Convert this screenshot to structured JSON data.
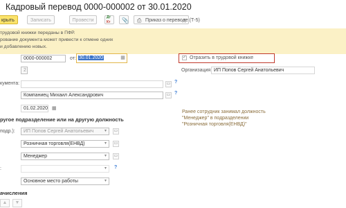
{
  "title": "Кадровый перевод 0000-000002 от 30.01.2020",
  "toolbar": {
    "close_label": "крыть",
    "save_label": "Записать",
    "post_label": "Провести",
    "order_label": "Приказ о переводе (Т-5)"
  },
  "notice": {
    "line1": "трудовой книжки переданы в ПФР.",
    "line2": "рование документа может привести к отмене одних",
    "line3": "и добавлению новых."
  },
  "doc": {
    "number": "0000-000002",
    "date_label": "от:",
    "date": "30.01.2020",
    "small_field": "2"
  },
  "reflect_checkbox": {
    "label": "Отразить в трудовой книжке",
    "checked": true
  },
  "organization": {
    "label": "Организация:",
    "value": "ИП Попов Сергей Анатольевич"
  },
  "employee": {
    "doc_label": "кумента:",
    "name": "Компаниец Михаил Александрович",
    "date": "01.02.2020"
  },
  "transfer": {
    "section_label": "ругое подразделение или на другую должность",
    "org_label": "подр.):",
    "org_value": "ИП Попов Сергей Анатольевич",
    "department": "Розничная торговля(ЕНВД)",
    "position": "Менеджер",
    "work_type": "Основное место работы"
  },
  "previous": {
    "line1": "Ранее сотрудник занимал должность",
    "line2": "\"Менеджер\" в подразделении",
    "line3": "\"Розничная торговля(ЕНВД)\""
  },
  "accruals": {
    "section_label": "ачисления"
  },
  "colors": {
    "accent_yellow": "#fbe36b",
    "notice_bg": "#fbf1c6",
    "highlight_red": "#c0392b",
    "date_blue": "#3b73c8"
  }
}
